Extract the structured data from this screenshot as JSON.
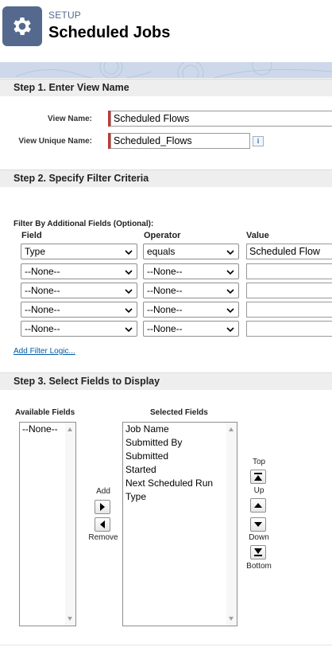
{
  "header": {
    "setup_label": "SETUP",
    "title": "Scheduled Jobs",
    "icon": "gear-icon"
  },
  "step1": {
    "heading": "Step 1. Enter View Name",
    "view_name_label": "View Name:",
    "view_name_value": "Scheduled Flows",
    "unique_name_label": "View Unique Name:",
    "unique_name_value": "Scheduled_Flows",
    "info_glyph": "i"
  },
  "step2": {
    "heading": "Step 2. Specify Filter Criteria",
    "filter_title": "Filter By Additional Fields (Optional):",
    "col_field": "Field",
    "col_operator": "Operator",
    "col_value": "Value",
    "rows": [
      {
        "field": "Type",
        "operator": "equals",
        "value": "Scheduled Flow"
      },
      {
        "field": "--None--",
        "operator": "--None--",
        "value": ""
      },
      {
        "field": "--None--",
        "operator": "--None--",
        "value": ""
      },
      {
        "field": "--None--",
        "operator": "--None--",
        "value": ""
      },
      {
        "field": "--None--",
        "operator": "--None--",
        "value": ""
      }
    ],
    "add_filter_logic": "Add Filter Logic..."
  },
  "step3": {
    "heading": "Step 3. Select Fields to Display",
    "available_label": "Available Fields",
    "selected_label": "Selected Fields",
    "available_items": [
      "--None--"
    ],
    "selected_items": [
      "Job Name",
      "Submitted By",
      "Submitted",
      "Started",
      "Next Scheduled Run",
      "Type"
    ],
    "add_label": "Add",
    "remove_label": "Remove",
    "top_label": "Top",
    "up_label": "Up",
    "down_label": "Down",
    "bottom_label": "Bottom"
  },
  "colors": {
    "brand_icon_bg": "#54698d",
    "required_marker": "#c23934",
    "link": "#015ba7"
  }
}
